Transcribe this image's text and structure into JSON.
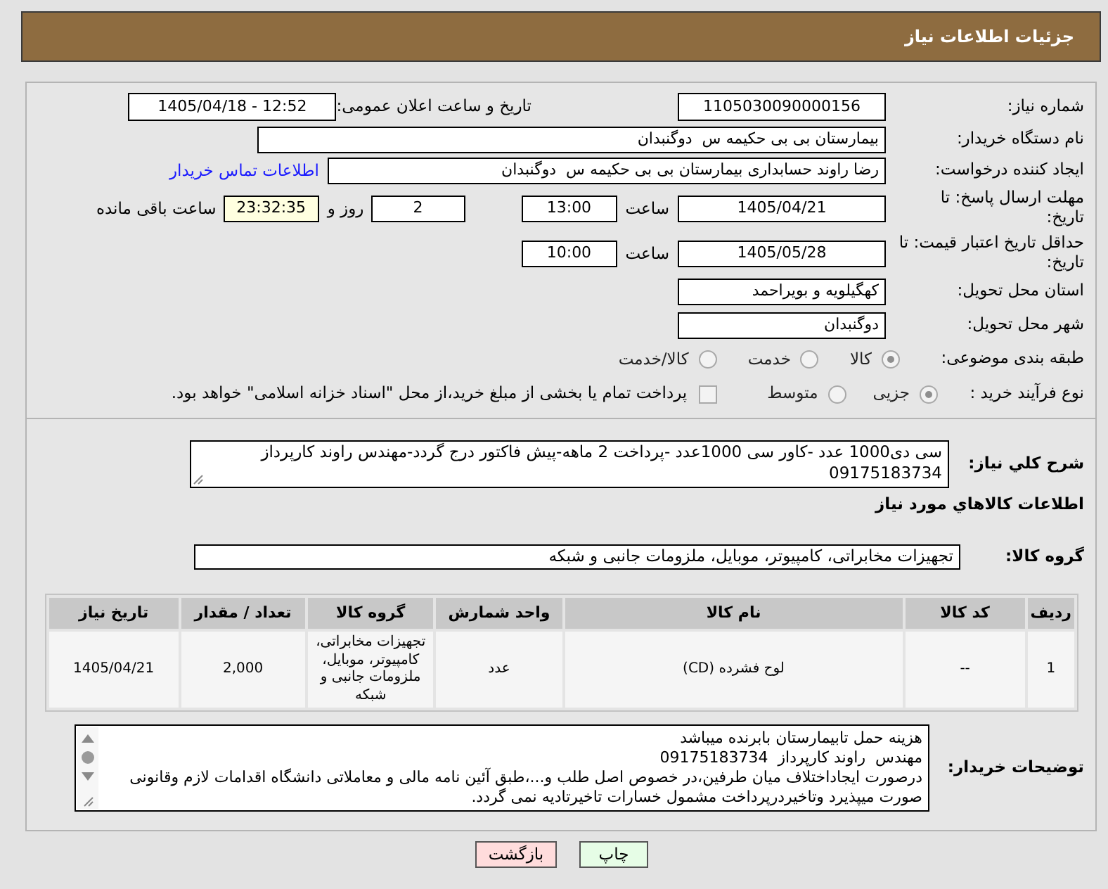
{
  "header": {
    "title": "جزئیات اطلاعات نیاز"
  },
  "need_details": {
    "need_number": {
      "label": "شماره نیاز:",
      "value": "1105030090000156"
    },
    "announcement": {
      "label": "تاریخ و ساعت اعلان عمومی:",
      "value": "1405/04/18 - 12:52"
    },
    "buyer_organization": {
      "label": "نام دستگاه خریدار:",
      "value": "بیمارستان بی بی حکیمه س  دوگنبدان"
    },
    "requester": {
      "label": "ایجاد کننده درخواست:",
      "value": "رضا راوند حسابداری بیمارستان بی بی حکیمه س  دوگنبدان",
      "contact_link": "اطلاعات تماس خریدار"
    },
    "response_deadline": {
      "label": "مهلت ارسال پاسخ: تا تاریخ:",
      "date": "1405/04/21",
      "time_label": "ساعت",
      "time": "13:00",
      "days": "2",
      "days_label": "روز و",
      "remaining_time": "23:32:35",
      "remaining_label": "ساعت باقی مانده"
    },
    "price_validity": {
      "label": "حداقل تاریخ اعتبار قیمت: تا تاریخ:",
      "date": "1405/05/28",
      "time_label": "ساعت",
      "time": "10:00"
    },
    "delivery_province": {
      "label": "استان محل تحویل:",
      "value": "کهگیلویه و بویراحمد"
    },
    "delivery_city": {
      "label": "شهر محل تحویل:",
      "value": "دوگنبدان"
    },
    "subject_category": {
      "label": "طبقه بندی موضوعی:",
      "options": [
        {
          "label": "کالا",
          "selected": true
        },
        {
          "label": "خدمت",
          "selected": false
        },
        {
          "label": "کالا/خدمت",
          "selected": false
        }
      ]
    },
    "purchase_process": {
      "label": "نوع فرآیند خرید :",
      "options": [
        {
          "label": "جزیی",
          "selected": true
        },
        {
          "label": "متوسط",
          "selected": false
        }
      ],
      "treasury_payment": {
        "label": "پرداخت تمام یا بخشی از مبلغ خرید،از محل \"اسناد خزانه اسلامی\" خواهد بود.",
        "checked": false
      }
    }
  },
  "description": {
    "label": "شرح کلي نياز:",
    "value": "سی دی1000 عدد -کاور سی 1000عدد -پرداخت 2 ماهه-پیش فاکتور درج گردد-مهندس راوند کارپرداز 09175183734"
  },
  "goods_title": "اطلاعات کالاهاي مورد نياز",
  "goods_group": {
    "label": "گروه کالا:",
    "value": "تجهیزات مخابراتی، کامپیوتر، موبایل، ملزومات جانبی و شبکه"
  },
  "goods_table": {
    "columns": [
      "ردیف",
      "کد کالا",
      "نام کالا",
      "واحد شمارش",
      "گروه کالا",
      "تعداد / مقدار",
      "تاریخ نیاز"
    ],
    "rows": [
      [
        "1",
        "--",
        "لوح فشرده (CD)",
        "عدد",
        "تجهیزات مخابراتی، کامپیوتر، موبایل، ملزومات جانبی و شبکه",
        "2,000",
        "1405/04/21"
      ]
    ]
  },
  "buyer_notes": {
    "label": "توضیحات خریدار:",
    "value": "هزینه حمل تابیمارستان بابرنده میباشد\nمهندس  راوند کارپرداز  09175183734\nدرصورت ایجاداختلاف میان طرفین،در خصوص اصل طلب و...،طبق آئین نامه مالی و معاملاتی دانشگاه اقدامات لازم وقانونی صورت میپذیرد وتاخیردرپرداخت مشمول خسارات تاخیرتادیه نمی گردد."
  },
  "buttons": [
    {
      "label": "چاپ",
      "kind": "print"
    },
    {
      "label": "بازگشت",
      "kind": "back"
    }
  ]
}
